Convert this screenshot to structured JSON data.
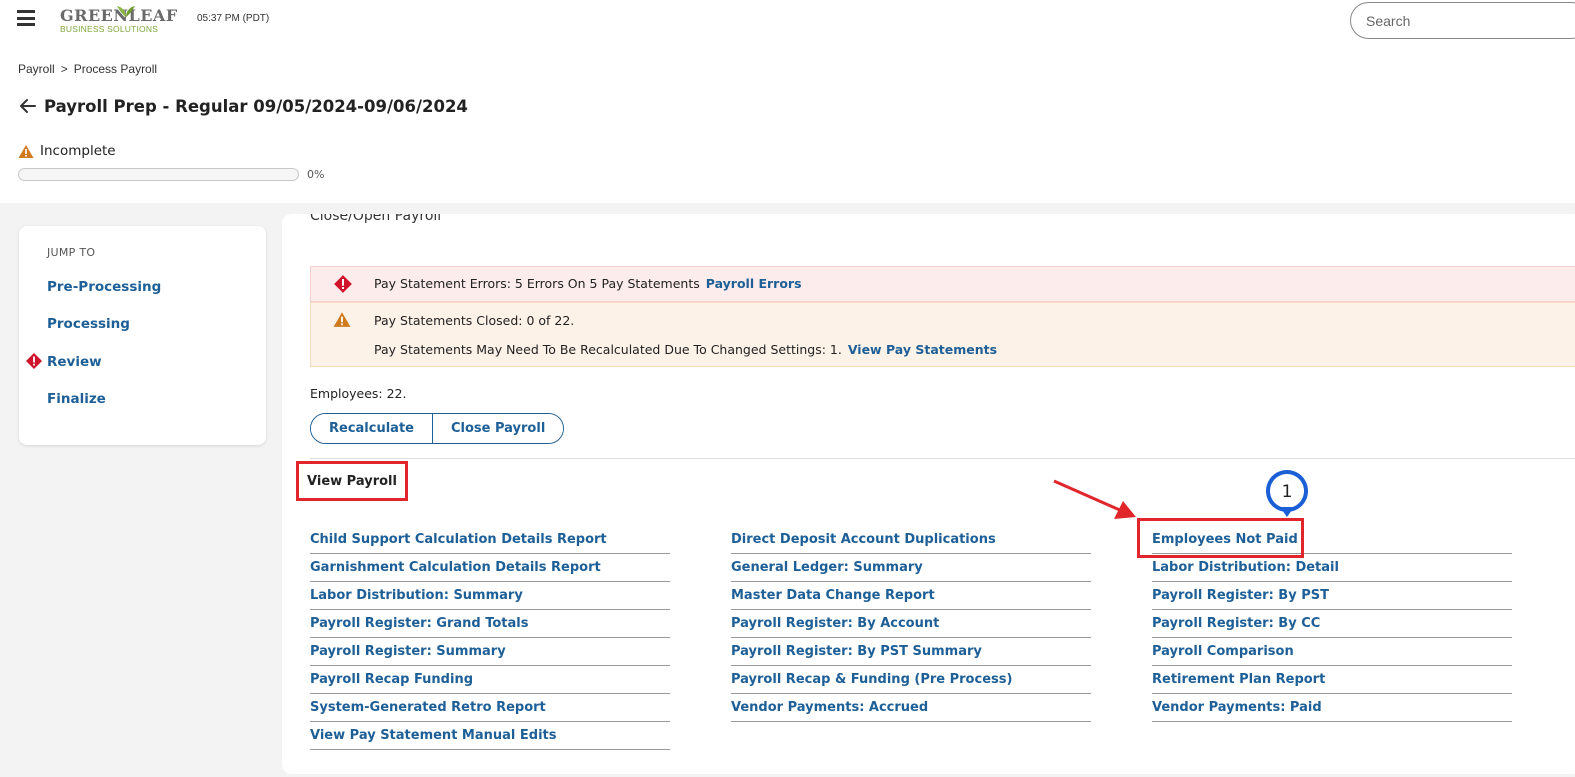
{
  "header": {
    "logo_main": "GREENLEAF",
    "logo_sub": "BUSINESS SOLUTIONS",
    "time": "05:37 PM (PDT)",
    "search_placeholder": "Search"
  },
  "breadcrumb": {
    "items": [
      "Payroll",
      "Process Payroll"
    ],
    "separator": ">"
  },
  "page": {
    "title": "Payroll Prep - Regular 09/05/2024-09/06/2024",
    "status": "Incomplete",
    "progress_value": 0,
    "progress_label": "0%"
  },
  "jump_to": {
    "title": "JUMP TO",
    "items": [
      "Pre-Processing",
      "Processing",
      "Review",
      "Finalize"
    ]
  },
  "main": {
    "cut_heading": "Close/Open Payroll",
    "error_alert": {
      "text": "Pay Statement Errors: 5 Errors On 5 Pay Statements",
      "link": "Payroll Errors"
    },
    "warning_alert": {
      "line1": "Pay Statements Closed: 0 of 22.",
      "line2": "Pay Statements May Need To Be Recalculated Due To Changed Settings: 1.",
      "link": "View Pay Statements"
    },
    "employees": "Employees: 22.",
    "buttons": {
      "recalculate": "Recalculate",
      "close_payroll": "Close Payroll"
    },
    "view_payroll": "View Payroll",
    "reports_col1": [
      "Child Support Calculation Details Report",
      "Garnishment Calculation Details Report",
      "Labor Distribution: Summary",
      "Payroll Register: Grand Totals",
      "Payroll Register: Summary",
      "Payroll Recap Funding",
      "System-Generated Retro Report",
      "View Pay Statement Manual Edits"
    ],
    "reports_col2": [
      "Direct Deposit Account Duplications",
      "General Ledger: Summary",
      "Master Data Change Report",
      "Payroll Register: By Account",
      "Payroll Register: By PST Summary",
      "Payroll Recap & Funding (Pre Process)",
      "Vendor Payments: Accrued"
    ],
    "reports_col3": [
      "Employees Not Paid",
      "Labor Distribution: Detail",
      "Payroll Register: By PST",
      "Payroll Register: By CC",
      "Payroll Comparison",
      "Retirement Plan Report",
      "Vendor Payments: Paid"
    ]
  },
  "annotation": {
    "step_number": "1"
  },
  "colors": {
    "link": "#1d5f96",
    "error_red": "#d0142c",
    "warning_orange": "#d07a1e",
    "highlight_red": "#e0262b",
    "marker_blue": "#1a5fd6",
    "brand_green": "#7fa63a"
  },
  "icons": {
    "menu": "hamburger-menu-icon",
    "back": "arrow-left-icon",
    "status": "warning-triangle-icon",
    "error": "error-diamond-icon"
  }
}
